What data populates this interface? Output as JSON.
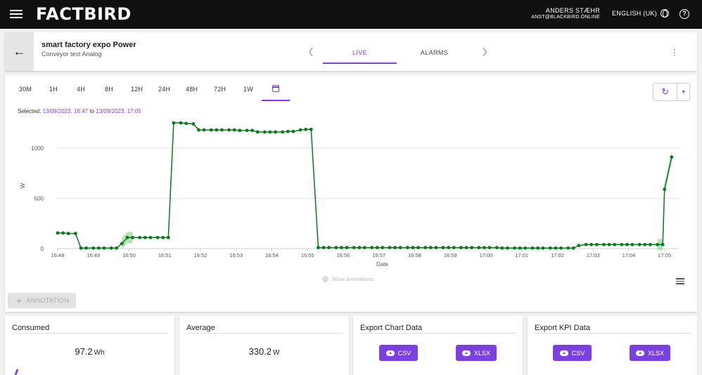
{
  "app": {
    "logo": "FACTBIRD"
  },
  "user": {
    "name": "ANDERS STÆHR",
    "email": "ANST@BLACKBIRD.ONLINE"
  },
  "language": "ENGLISH (UK)",
  "line": {
    "title": "smart factory expo Power",
    "subtitle": "Conveyor test Analog"
  },
  "tabs": [
    {
      "label": "LIVE",
      "active": true
    },
    {
      "label": "ALARMS",
      "active": false
    }
  ],
  "time_ranges": [
    "30M",
    "1H",
    "4H",
    "8H",
    "12H",
    "24H",
    "48H",
    "72H",
    "1W"
  ],
  "selected": {
    "prefix": "Selected:",
    "from": "13/09/2023, 16:47",
    "connector": "to",
    "to": "13/09/2023, 17:05"
  },
  "chart_data": {
    "type": "line",
    "xlabel": "Date",
    "ylabel": "W",
    "ylim": [
      0,
      1250
    ],
    "y_ticks": [
      0,
      500,
      1000
    ],
    "x_ticks": [
      "16:48",
      "16:49",
      "16:50",
      "16:51",
      "16:52",
      "16:53",
      "16:54",
      "16:55",
      "16:56",
      "16:57",
      "16:58",
      "16:59",
      "17:00",
      "17:01",
      "17:02",
      "17:03",
      "17:04",
      "17:05"
    ],
    "x_min": 0,
    "x_max": 17.4,
    "color": "#0b7a1e",
    "band_color": "#a6d9a6",
    "series": [
      {
        "x": [
          0,
          0.15,
          0.3,
          0.5,
          0.65,
          0.8,
          1.0,
          1.15,
          1.3,
          1.5,
          1.65,
          1.8,
          1.95,
          2.1,
          2.3,
          2.45,
          2.6,
          2.8,
          2.95,
          3.1,
          3.25,
          3.45,
          3.6,
          3.8,
          3.95,
          4.1,
          4.3,
          4.45,
          4.6,
          4.8,
          4.95,
          5.1,
          5.3,
          5.45,
          5.6,
          5.8,
          5.95,
          6.1,
          6.3,
          6.45,
          6.6,
          6.8,
          6.95,
          7.1,
          7.3,
          7.45,
          7.6,
          7.8,
          7.95,
          8.1,
          8.3,
          8.45,
          8.6,
          8.8,
          8.95,
          9.1,
          9.3,
          9.45,
          9.6,
          9.8,
          9.95,
          10.1,
          10.3,
          10.45,
          10.6,
          10.8,
          10.95,
          11.1,
          11.3,
          11.45,
          11.6,
          11.8,
          11.95,
          12.1,
          12.3,
          12.45,
          12.6,
          12.8,
          12.95,
          13.1,
          13.3,
          13.45,
          13.6,
          13.8,
          13.95,
          14.1,
          14.3,
          14.45,
          14.6,
          14.8,
          14.95,
          15.1,
          15.3,
          15.45,
          15.6,
          15.8,
          15.95,
          16.1,
          16.3,
          16.45,
          16.6,
          16.8,
          16.95,
          17.0,
          17.2
        ],
        "y": [
          155,
          155,
          150,
          150,
          5,
          5,
          5,
          5,
          5,
          5,
          5,
          50,
          110,
          110,
          110,
          110,
          110,
          110,
          110,
          110,
          1250,
          1250,
          1245,
          1240,
          1180,
          1180,
          1180,
          1180,
          1180,
          1180,
          1180,
          1175,
          1175,
          1175,
          1160,
          1160,
          1160,
          1160,
          1160,
          1165,
          1165,
          1180,
          1185,
          1185,
          10,
          10,
          10,
          10,
          10,
          10,
          10,
          10,
          10,
          10,
          10,
          10,
          10,
          10,
          10,
          10,
          10,
          10,
          10,
          10,
          10,
          10,
          10,
          10,
          10,
          10,
          10,
          10,
          10,
          10,
          10,
          5,
          5,
          5,
          5,
          5,
          5,
          5,
          5,
          5,
          5,
          5,
          5,
          5,
          30,
          40,
          40,
          40,
          40,
          40,
          40,
          40,
          40,
          40,
          40,
          40,
          40,
          40,
          40,
          590,
          910
        ]
      }
    ],
    "annotations_toggle": "Show annotations"
  },
  "annotation_button": "ANNOTATION",
  "kpis": [
    {
      "title": "Consumed",
      "value": "97.2",
      "unit": "Wh"
    },
    {
      "title": "Average",
      "value": "330.2",
      "unit": "W"
    }
  ],
  "exports": [
    {
      "title": "Export Chart Data",
      "csv": "CSV",
      "xlsx": "XLSX"
    },
    {
      "title": "Export KPI Data",
      "csv": "CSV",
      "xlsx": "XLSX"
    }
  ]
}
